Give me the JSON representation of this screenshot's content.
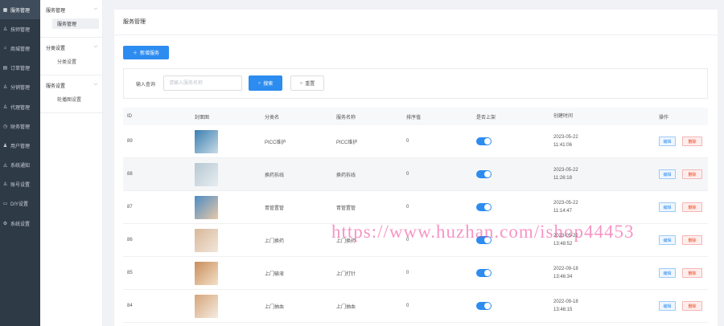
{
  "sidebar": {
    "items": [
      {
        "label": "服务管理",
        "icon": "grid-icon",
        "active": true
      },
      {
        "label": "技师管理",
        "icon": "user-icon"
      },
      {
        "label": "商城管理",
        "icon": "shop-icon"
      },
      {
        "label": "订单管理",
        "icon": "document-icon"
      },
      {
        "label": "分销管理",
        "icon": "share-icon"
      },
      {
        "label": "代理管理",
        "icon": "agent-icon"
      },
      {
        "label": "财务管理",
        "icon": "clock-icon"
      },
      {
        "label": "用户管理",
        "icon": "users-icon"
      },
      {
        "label": "系统通知",
        "icon": "bell-icon"
      },
      {
        "label": "账号设置",
        "icon": "account-icon"
      },
      {
        "label": "DIY设置",
        "icon": "diy-icon"
      },
      {
        "label": "系统设置",
        "icon": "settings-icon"
      }
    ]
  },
  "submenu": {
    "groups": [
      {
        "title": "服务管理",
        "child": "服务管理",
        "active": true
      },
      {
        "title": "分类设置",
        "child": "分类设置"
      },
      {
        "title": "服务设置",
        "child": "轮播图设置"
      }
    ]
  },
  "header": {
    "title": "服务管理"
  },
  "toolbar": {
    "add_label": "新增服务"
  },
  "search": {
    "label": "输入查询",
    "placeholder": "请输入服务名称",
    "search_label": "搜索",
    "reset_label": "重置"
  },
  "table": {
    "columns": [
      "ID",
      "封面图",
      "分类名",
      "服务名称",
      "排序值",
      "是否上架",
      "创建时间",
      "操作"
    ],
    "rows": [
      {
        "id": "89",
        "category": "PICC维护",
        "name": "PICC维护",
        "sort": "0",
        "on_shelf": true,
        "date": "2023-05-22",
        "time": "11:41:06",
        "thumb": [
          "#3a7fb0",
          "#c9dbe6"
        ]
      },
      {
        "id": "88",
        "category": "换药拆线",
        "name": "换药拆线",
        "sort": "0",
        "on_shelf": true,
        "date": "2023-05-22",
        "time": "11:26:18",
        "thumb": [
          "#b7c8d2",
          "#e6edf1"
        ]
      },
      {
        "id": "87",
        "category": "胃管置管",
        "name": "胃管置管",
        "sort": "0",
        "on_shelf": true,
        "date": "2023-05-22",
        "time": "11:14:47",
        "thumb": [
          "#4d8cc4",
          "#e8c9a8"
        ]
      },
      {
        "id": "86",
        "category": "上门换药",
        "name": "上门换药",
        "sort": "0",
        "on_shelf": true,
        "date": "2023-05-22",
        "time": "13:48:52",
        "thumb": [
          "#d8b89a",
          "#f2e6da"
        ]
      },
      {
        "id": "85",
        "category": "上门输液",
        "name": "上门打针",
        "sort": "0",
        "on_shelf": true,
        "date": "2022-09-18",
        "time": "13:46:34",
        "thumb": [
          "#c98e5c",
          "#f3e0c8"
        ]
      },
      {
        "id": "84",
        "category": "上门抽血",
        "name": "上门抽血",
        "sort": "0",
        "on_shelf": true,
        "date": "2022-09-18",
        "time": "13:46:15",
        "thumb": [
          "#d6a57a",
          "#f5ece2"
        ]
      }
    ],
    "edit_label": "编辑",
    "delete_label": "删除"
  },
  "watermark": "https://www.huzhan.com/ishop44453",
  "colors": {
    "primary": "#2d8cf0",
    "danger": "#ed4014",
    "sidebar": "#2f3a47"
  }
}
